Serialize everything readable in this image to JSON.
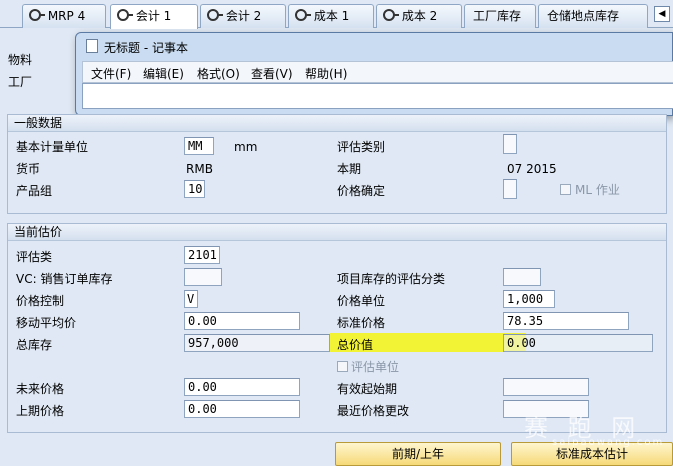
{
  "tabs": [
    {
      "label": "MRP 4"
    },
    {
      "label": "会计 1"
    },
    {
      "label": "会计 2"
    },
    {
      "label": "成本 1"
    },
    {
      "label": "成本 2"
    },
    {
      "label": "工厂库存"
    },
    {
      "label": "仓储地点库存"
    }
  ],
  "tab_nav": {
    "prev": "◀"
  },
  "header": {
    "material_label": "物料",
    "plant_label": "工厂"
  },
  "notepad": {
    "title": "无标题 - 记事本",
    "menus": [
      "文件(F)",
      "编辑(E)",
      "格式(O)",
      "查看(V)",
      "帮助(H)"
    ],
    "text": ""
  },
  "general": {
    "title": "一般数据",
    "base_uom_label": "基本计量单位",
    "base_uom_value": "MM",
    "base_uom_text": "mm",
    "valuation_category_label": "评估类别",
    "currency_label": "货币",
    "currency_value": "RMB",
    "current_period_label": "本期",
    "current_period_value": "07 2015",
    "product_group_label": "产品组",
    "product_group_value": "10",
    "price_determination_label": "价格确定",
    "ml_label": "ML 作业"
  },
  "valuation": {
    "title": "当前估价",
    "valuation_class_label": "评估类",
    "valuation_class_value": "2101",
    "vc_sales_label": "VC: 销售订单库存",
    "project_stock_label": "项目库存的评估分类",
    "price_control_label": "价格控制",
    "price_control_value": "V",
    "price_unit_label": "价格单位",
    "price_unit_value": "1,000",
    "moving_avg_label": "移动平均价",
    "moving_avg_value": "0.00",
    "standard_price_label": "标准价格",
    "standard_price_value": "78.35",
    "total_stock_label": "总库存",
    "total_stock_value": "957,000",
    "total_value_label": "总价值",
    "total_value_value": "0.00",
    "valuated_unit_label": "评估单位",
    "future_price_label": "未来价格",
    "future_price_value": "0.00",
    "valid_from_label": "有效起始期",
    "prev_price_label": "上期价格",
    "prev_price_value": "0.00",
    "last_price_change_label": "最近价格更改"
  },
  "buttons": {
    "prev_period": "前期/上年",
    "std_cost_estimate": "标准成本估计"
  },
  "watermark": {
    "text": "赛 跑 网",
    "sub": "saipaowang.com"
  },
  "colors": {
    "highlight": "#f7f414",
    "button": "#f6d978",
    "background": "#dfe8f4"
  }
}
